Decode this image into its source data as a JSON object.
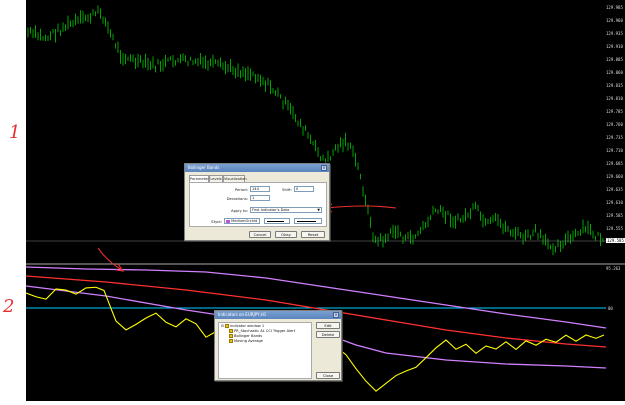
{
  "annotations": {
    "label_1": "1",
    "label_2": "2"
  },
  "price_axis": {
    "labels": [
      "129.985",
      "129.960",
      "129.935",
      "129.910",
      "129.885",
      "129.860",
      "129.835",
      "129.810",
      "129.785",
      "129.760",
      "129.735",
      "129.710",
      "129.685",
      "129.660",
      "129.635",
      "129.610",
      "129.585",
      "129.555"
    ],
    "current_price": "129.585"
  },
  "indicator_axis": {
    "top_label": "95.263",
    "level_label": "80"
  },
  "bands_dialog": {
    "title": "Bollinger Bands",
    "close": "×",
    "tabs": [
      "Parameters",
      "Levels",
      "Visualization"
    ],
    "period_label": "Period:",
    "period_value": "144",
    "shift_label": "Shift:",
    "shift_value": "0",
    "deviations_label": "Deviations:",
    "deviations_value": "1",
    "apply_to_label": "Apply to:",
    "apply_to_value": "First Indicator's Data",
    "style_label": "Style:",
    "style_color_name": "MediumOrchid",
    "style_color": "#ba55d3",
    "buttons": [
      "Okay",
      "Cancel",
      "Reset"
    ],
    "buttons_order_visible": [
      "Cancel",
      "Okay",
      "Reset"
    ]
  },
  "indicators_dialog": {
    "title": "Indicators on EURJPY,H1",
    "close": "×",
    "tree": {
      "root": "Indicator window 1",
      "items": [
        "PR_Stochastic AL CCI Trigger Alert",
        "Bollinger Bands",
        "Moving Average"
      ]
    },
    "buttons": {
      "edit": "Edit",
      "delete": "Delete",
      "close": "Close"
    }
  },
  "colors": {
    "background": "#000000",
    "candles": "#00cc00",
    "upper_band": "#d080ff",
    "middle_band": "#ff3030",
    "oscillator": "#ffff00",
    "level_line": "#00d0ff",
    "annotation": "#e53030"
  }
}
